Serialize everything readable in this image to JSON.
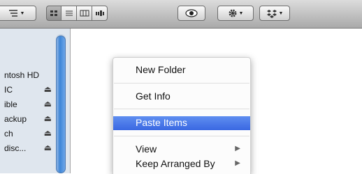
{
  "toolbar": {
    "view_modes": [
      "icon-view",
      "list-view",
      "column-view",
      "coverflow-view"
    ],
    "active_view": "icon-view"
  },
  "sidebar": {
    "items": [
      {
        "label": "ntosh HD",
        "eject": false
      },
      {
        "label": "IC",
        "eject": true
      },
      {
        "label": "ible",
        "eject": true
      },
      {
        "label": "ackup",
        "eject": true
      },
      {
        "label": "ch",
        "eject": true
      },
      {
        "label": "disc...",
        "eject": true
      }
    ]
  },
  "context_menu": {
    "items": [
      {
        "label": "New Folder",
        "submenu": false,
        "highlighted": false
      },
      {
        "label": "Get Info",
        "submenu": false,
        "highlighted": false
      },
      {
        "label": "Paste Items",
        "submenu": false,
        "highlighted": true
      },
      {
        "label": "View",
        "submenu": true,
        "highlighted": false
      },
      {
        "label": "Keep Arranged By",
        "submenu": true,
        "highlighted": false
      }
    ]
  },
  "colors": {
    "highlight": "#3a68e2",
    "sidebar_bg": "#dfe6ee",
    "scroll_thumb": "#3d85d6"
  }
}
